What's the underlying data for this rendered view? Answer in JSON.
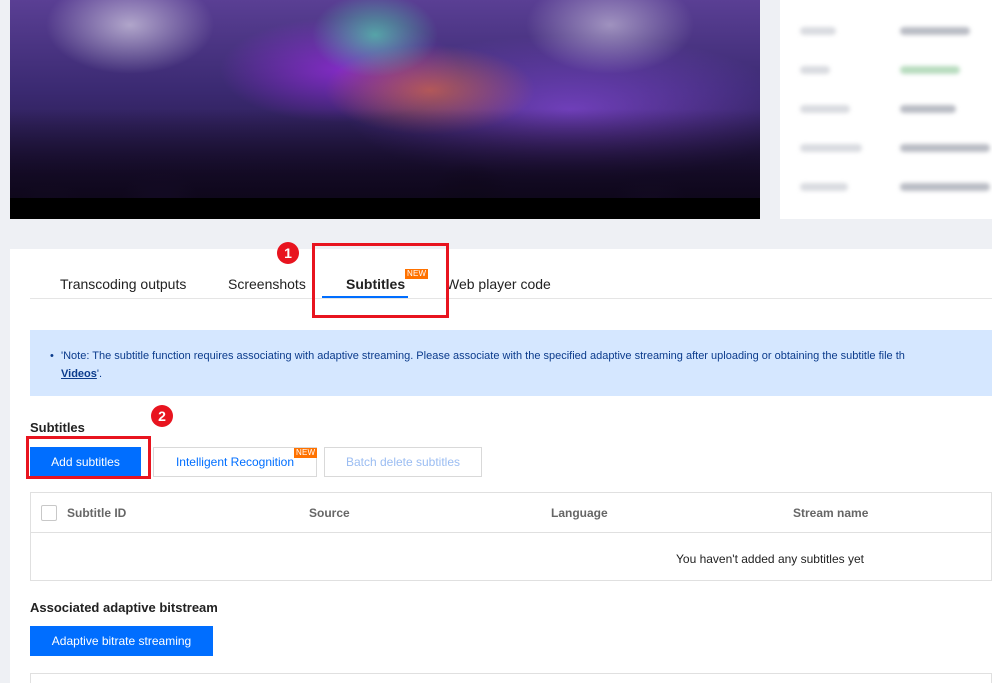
{
  "tabs": [
    {
      "label": "Transcoding outputs"
    },
    {
      "label": "Screenshots"
    },
    {
      "label": "Subtitles",
      "badge": "NEW"
    },
    {
      "label": "Web player code"
    }
  ],
  "notice": {
    "line1": "'Note: The subtitle function requires associating with adaptive streaming. Please associate with the specified adaptive streaming after uploading or obtaining the subtitle file th",
    "link": "Videos",
    "line2_suffix": "'."
  },
  "subtitles_section": {
    "title": "Subtitles",
    "add_button": "Add subtitles",
    "recognition_button": "Intelligent Recognition",
    "recognition_badge": "NEW",
    "batch_delete_button": "Batch delete subtitles",
    "columns": [
      "Subtitle ID",
      "Source",
      "Language",
      "Stream name"
    ],
    "empty_text": "You haven't added any subtitles yet"
  },
  "adaptive_section": {
    "title": "Associated adaptive bitstream",
    "button": "Adaptive bitrate streaming"
  },
  "annotations": [
    "1",
    "2"
  ],
  "colors": {
    "accent": "#006eff",
    "annotation": "#e8141f",
    "badge": "#ff7200",
    "notice_bg": "#d5e7ff"
  }
}
